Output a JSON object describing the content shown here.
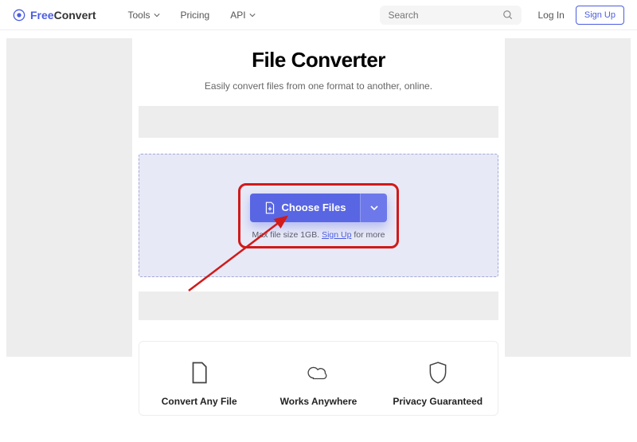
{
  "brand": {
    "free": "Free",
    "convert": "Convert"
  },
  "nav": {
    "tools": "Tools",
    "pricing": "Pricing",
    "api": "API"
  },
  "search": {
    "placeholder": "Search"
  },
  "auth": {
    "login": "Log In",
    "signup": "Sign Up"
  },
  "hero": {
    "title": "File Converter",
    "subtitle": "Easily convert files from one format to another, online."
  },
  "dropzone": {
    "choose": "Choose Files",
    "maxnote_prefix": "Max file size 1GB. ",
    "maxnote_link": "Sign Up",
    "maxnote_suffix": " for more"
  },
  "features": {
    "convert": "Convert Any File",
    "anywhere": "Works Anywhere",
    "privacy": "Privacy Guaranteed"
  }
}
